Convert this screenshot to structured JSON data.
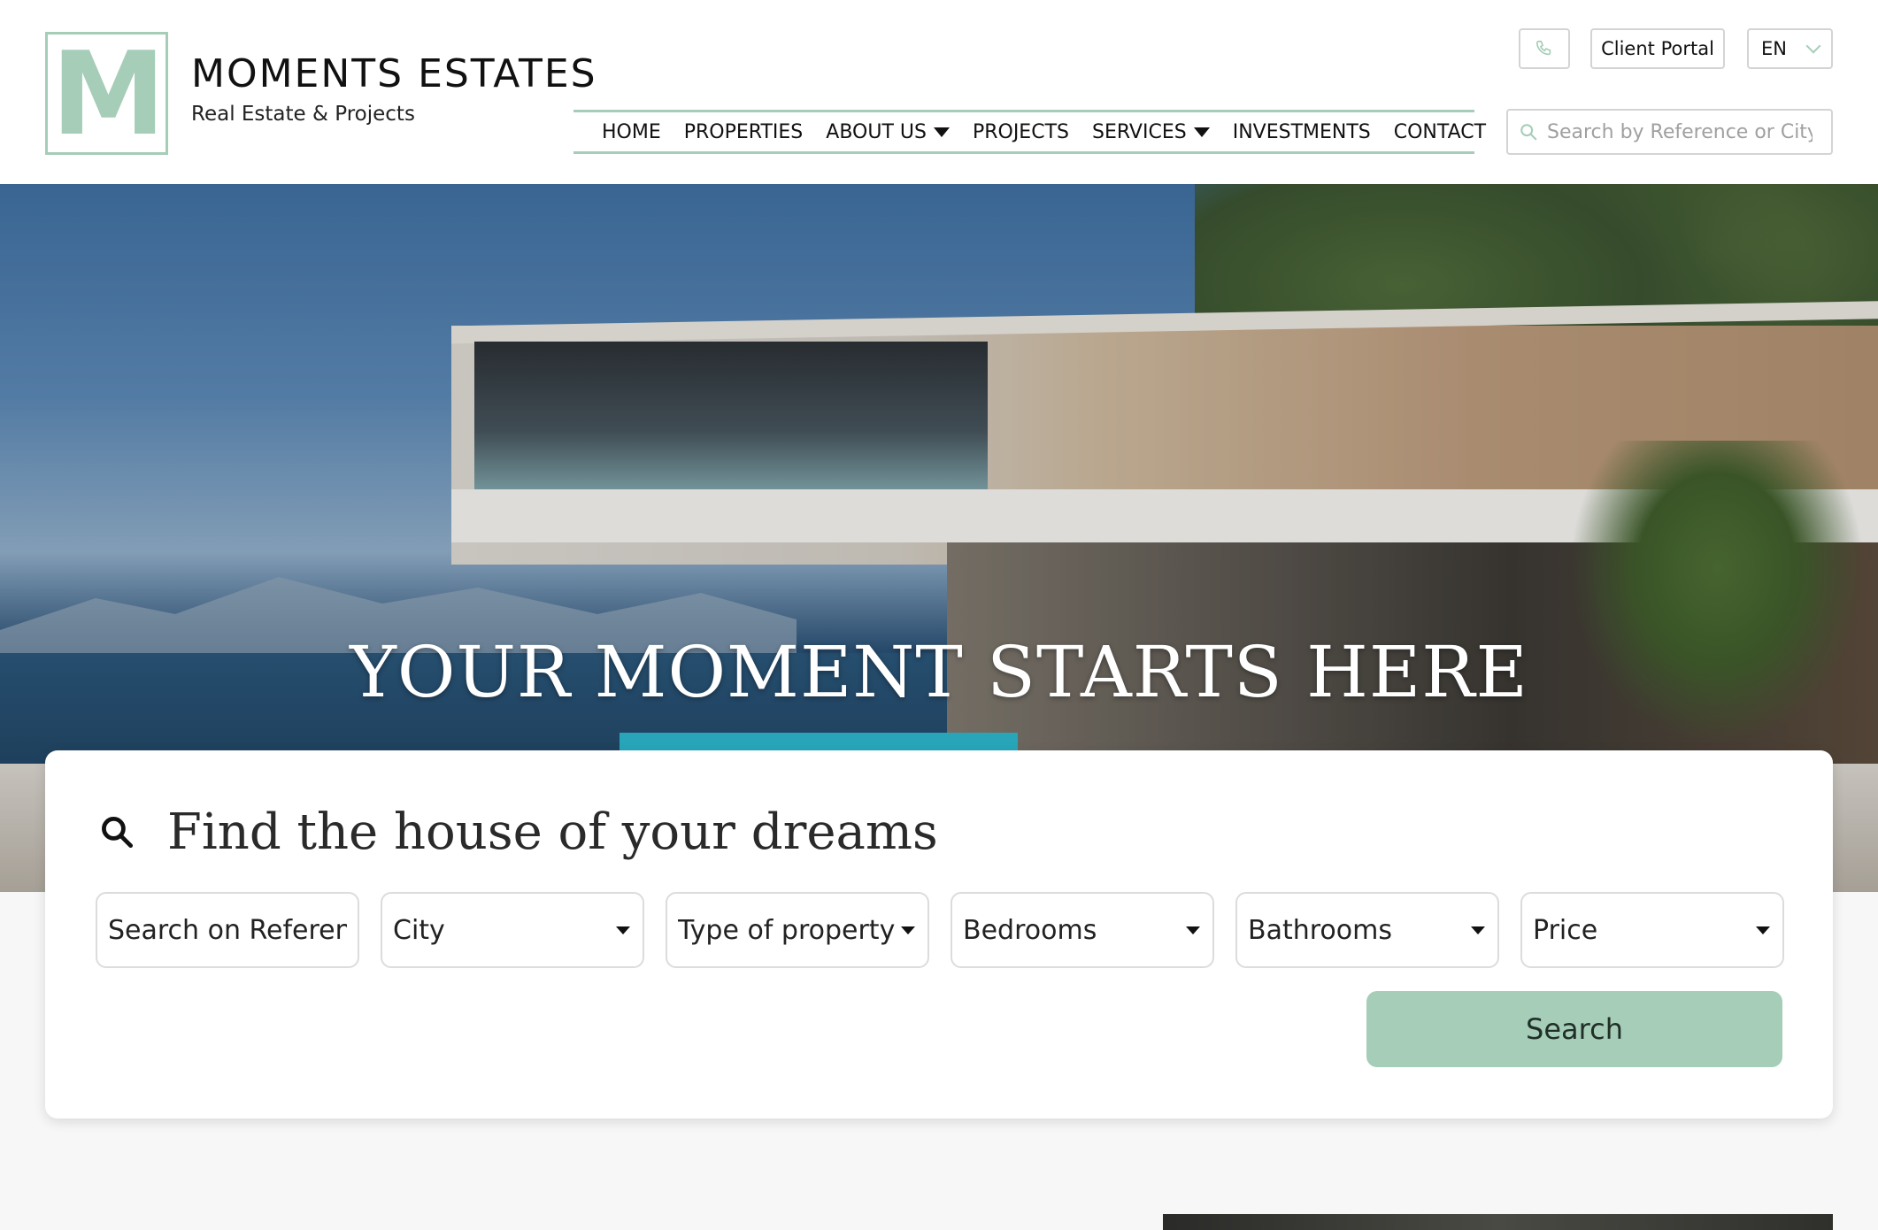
{
  "brand": {
    "logo_letter": "M",
    "name": "MOMENTS ESTATES",
    "tagline": "Real Estate & Projects"
  },
  "nav": {
    "items": [
      {
        "label": "HOME",
        "has_dropdown": false
      },
      {
        "label": "PROPERTIES",
        "has_dropdown": false
      },
      {
        "label": "ABOUT US",
        "has_dropdown": true
      },
      {
        "label": "PROJECTS",
        "has_dropdown": false
      },
      {
        "label": "SERVICES",
        "has_dropdown": true
      },
      {
        "label": "INVESTMENTS",
        "has_dropdown": false
      },
      {
        "label": "CONTACT",
        "has_dropdown": false
      }
    ]
  },
  "topbar": {
    "phone_icon": "phone-icon",
    "client_portal_label": "Client Portal",
    "language": "EN",
    "search_placeholder": "Search by Reference or City"
  },
  "hero": {
    "title": "YOUR MOMENT STARTS HERE"
  },
  "search_card": {
    "title": "Find the house of your dreams",
    "reference_placeholder": "Search on Reference",
    "filters": [
      {
        "label": "City"
      },
      {
        "label": "Type of property"
      },
      {
        "label": "Bedrooms"
      },
      {
        "label": "Bathrooms"
      },
      {
        "label": "Price"
      }
    ],
    "search_button_label": "Search"
  },
  "colors": {
    "accent": "#a6cdb8",
    "background": "#f7f7f7",
    "card": "#ffffff"
  }
}
